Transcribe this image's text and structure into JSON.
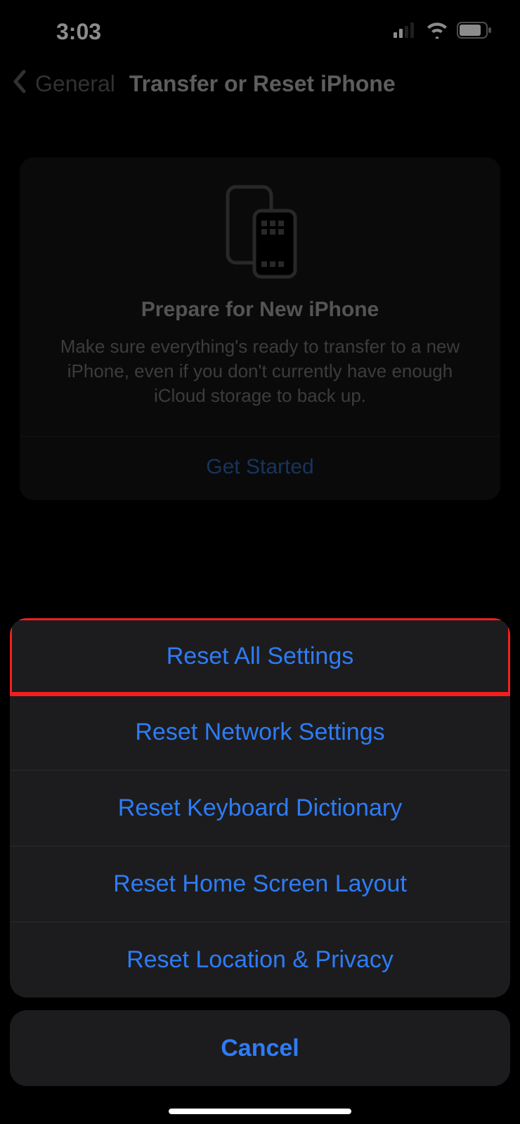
{
  "status": {
    "time": "3:03"
  },
  "nav": {
    "back_label": "General",
    "title": "Transfer or Reset iPhone"
  },
  "prepare": {
    "title": "Prepare for New iPhone",
    "description": "Make sure everything's ready to transfer to a new iPhone, even if you don't currently have enough iCloud storage to back up.",
    "action": "Get Started"
  },
  "sheet": {
    "items": [
      "Reset All Settings",
      "Reset Network Settings",
      "Reset Keyboard Dictionary",
      "Reset Home Screen Layout",
      "Reset Location & Privacy"
    ],
    "cancel": "Cancel"
  },
  "colors": {
    "link": "#2e7cf6",
    "highlight": "#f41d1d",
    "card_bg": "#131314",
    "sheet_bg": "#1c1c1e"
  }
}
